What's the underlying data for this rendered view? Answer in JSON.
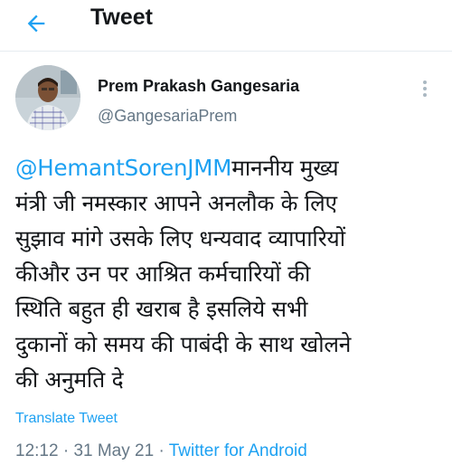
{
  "header": {
    "title": "Tweet",
    "back_icon": "arrow-left-icon",
    "accent": "#1da1f2"
  },
  "author": {
    "display_name": "Prem Prakash Gangesaria",
    "handle": "@GangesariaPrem",
    "avatar_icon": "profile-photo"
  },
  "tweet": {
    "mention": "@HemantSorenJMM",
    "lines": [
      "माननीय मुख्य",
      "मंत्री जी नमस्कार आपने अनलौक के लिए",
      "सुझाव मांगे उसके लिए धन्यवाद व्यापारियों",
      "कीऔर उन पर आश्रित कर्मचारियों की",
      "स्थिति बहुत ही खराब है इसलिये सभी",
      "दुकानों को समय की पाबंदी के साथ खोलने",
      "की अनुमति दे"
    ]
  },
  "translate_label": "Translate Tweet",
  "meta": {
    "time": "12:12",
    "sep1": " · ",
    "date": "31 May 21",
    "sep2": " · ",
    "source": "Twitter for Android"
  },
  "more_icon": "more-vertical-icon"
}
